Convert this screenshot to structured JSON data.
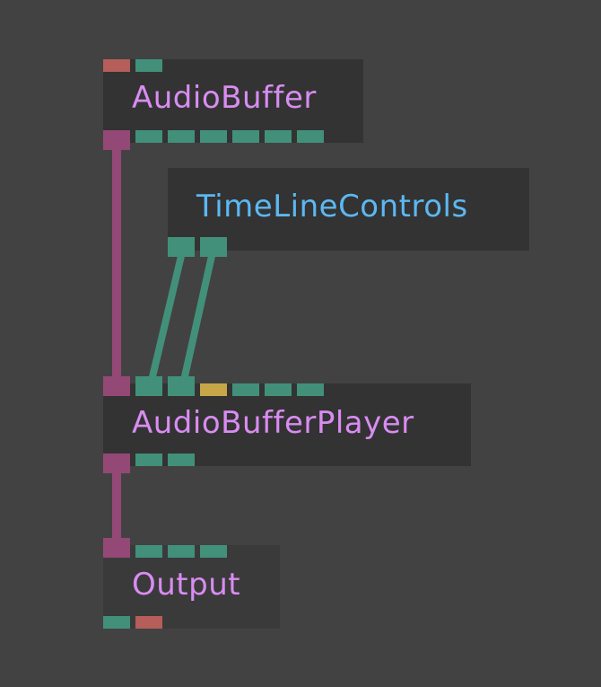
{
  "colors": {
    "background": "#424242",
    "node_bg": "#333333",
    "audio_port": "#944876",
    "value_port": "#42907a",
    "trigger_port": "#b55e5a",
    "number_port": "#c7a648",
    "title_audio": "#d98cf2",
    "title_control": "#5bb8f2"
  },
  "nodes": {
    "audio_buffer": {
      "title": "AudioBuffer"
    },
    "timeline_controls": {
      "title": "TimeLineControls"
    },
    "audio_buffer_player": {
      "title": "AudioBufferPlayer"
    },
    "output": {
      "title": "Output"
    }
  }
}
